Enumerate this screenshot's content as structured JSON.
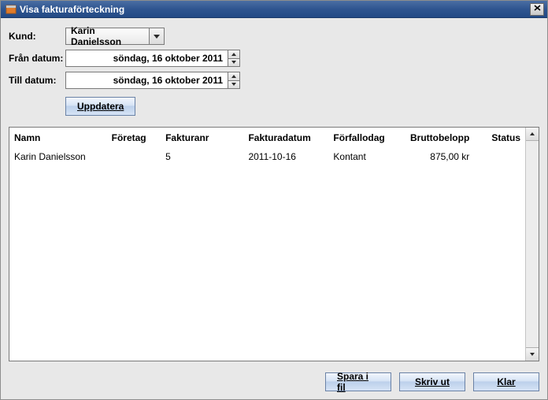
{
  "window": {
    "title": "Visa fakturaförteckning"
  },
  "form": {
    "customer_label": "Kund:",
    "customer_value": "Karin Danielsson",
    "from_label": "Från datum:",
    "from_value": "söndag, 16 oktober 2011",
    "to_label": "Till datum:",
    "to_value": "söndag, 16 oktober 2011",
    "update_label": "Uppdatera"
  },
  "table": {
    "columns": {
      "name": "Namn",
      "company": "Företag",
      "invoice_nr": "Fakturanr",
      "invoice_date": "Fakturadatum",
      "due_date": "Förfallodag",
      "gross": "Bruttobelopp",
      "status": "Status"
    },
    "rows": [
      {
        "name": "Karin Danielsson",
        "company": "",
        "invoice_nr": "5",
        "invoice_date": "2011-10-16",
        "due_date": "Kontant",
        "gross": "875,00 kr",
        "status": ""
      }
    ]
  },
  "footer": {
    "save_file": "Spara i fil",
    "print": "Skriv ut",
    "done": "Klar"
  }
}
